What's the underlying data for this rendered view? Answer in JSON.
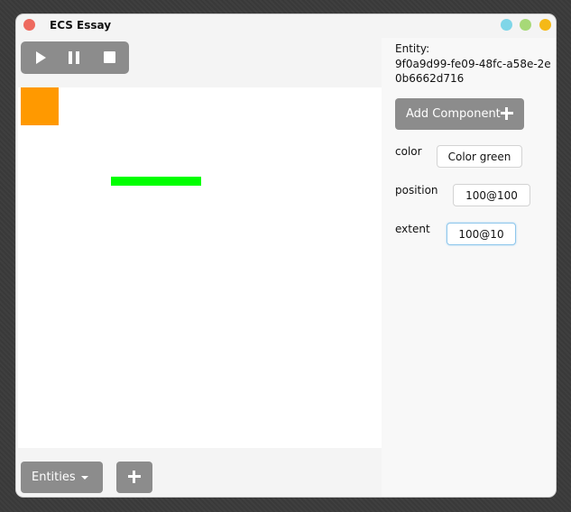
{
  "window": {
    "title": "ECS Essay"
  },
  "toolbar": {
    "buttons": [
      "play-icon",
      "pause-icon",
      "stop-icon"
    ]
  },
  "canvas": {
    "shapes": [
      {
        "name": "orange-square",
        "color": "#ff9900"
      },
      {
        "name": "green-bar",
        "color": "#00ff00"
      }
    ]
  },
  "bottom": {
    "entities_label": "Entities",
    "add_icon": "plus-icon"
  },
  "panel": {
    "entity_label": "Entity:",
    "entity_id": "9f0a9d99-fe09-48fc-a58e-2e0b6662d716",
    "add_component_label": "Add Component",
    "fields": [
      {
        "label": "color",
        "value": "Color green"
      },
      {
        "label": "position",
        "value": "100@100"
      },
      {
        "label": "extent",
        "value": "100@10"
      }
    ]
  },
  "colors": {
    "button_gray": "#8c8c8c",
    "close": "#ee6a5f",
    "focus_border": "#8fc7ec"
  }
}
